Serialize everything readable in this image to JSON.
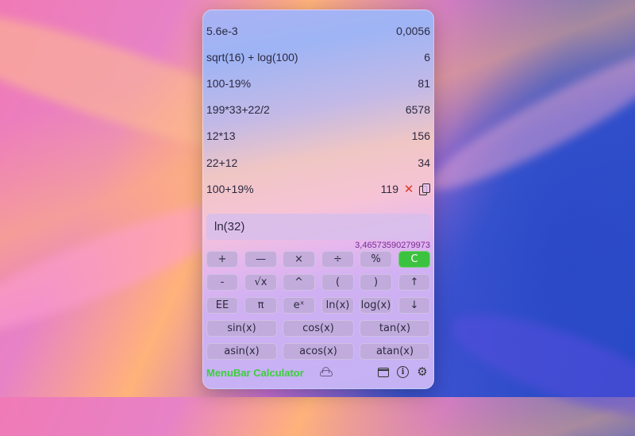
{
  "app": {
    "name": "MenuBar Calculator",
    "accent_color": "#3bc23f"
  },
  "history": [
    {
      "expr": "5.6e-3",
      "result": "0,0056"
    },
    {
      "expr": "sqrt(16) + log(100)",
      "result": "6"
    },
    {
      "expr": "100-19%",
      "result": "81"
    },
    {
      "expr": "199*33+22/2",
      "result": "6578"
    },
    {
      "expr": "12*13",
      "result": "156"
    },
    {
      "expr": "22+12",
      "result": "34"
    },
    {
      "expr": "100+19%",
      "result": "119"
    }
  ],
  "history_actions": {
    "delete_icon": "close-icon",
    "copy_icon": "copy-icon",
    "delete_glyph": "✕"
  },
  "input": {
    "value": "ln(32)",
    "result_preview": "3,46573590279973"
  },
  "keys": {
    "row1": [
      "+",
      "—",
      "×",
      "÷",
      "%",
      "C"
    ],
    "row2": [
      "-",
      "√x",
      "^",
      "(",
      ")",
      "↑"
    ],
    "row3": [
      "EE",
      "π",
      "eˣ",
      "ln(x)",
      "log(x)",
      "↓"
    ],
    "row4": [
      "sin(x)",
      "cos(x)",
      "tan(x)"
    ],
    "row5": [
      "asin(x)",
      "acos(x)",
      "atan(x)"
    ]
  },
  "footer": {
    "icons": [
      "cloud-icon",
      "window-icon",
      "info-icon",
      "gear-icon"
    ],
    "info_glyph": "i",
    "gear_glyph": "⚙"
  }
}
